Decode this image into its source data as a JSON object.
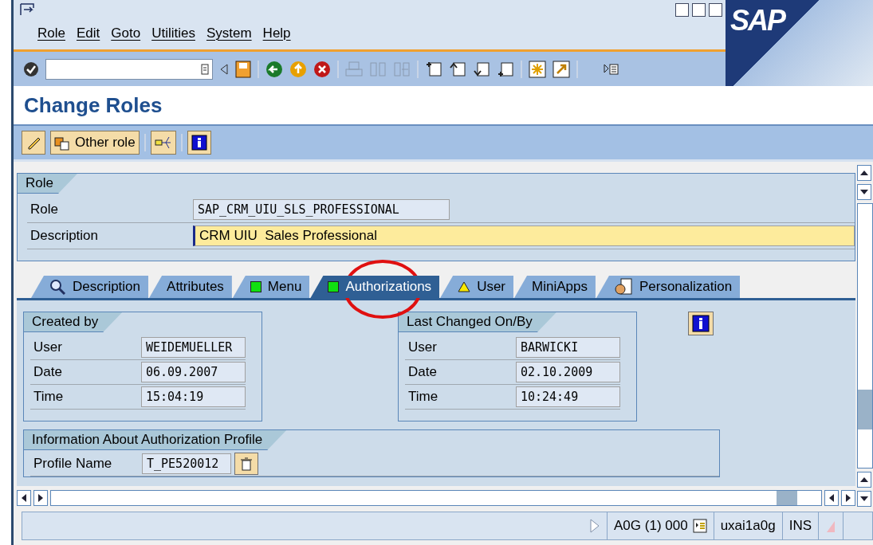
{
  "menu_bar": {
    "items": [
      "Role",
      "Edit",
      "Goto",
      "Utilities",
      "System",
      "Help"
    ]
  },
  "logo": "SAP",
  "title": "Change Roles",
  "app_toolbar": {
    "other_role_label": "Other role"
  },
  "role_group": {
    "title": "Role",
    "fields": [
      {
        "label": "Role",
        "value": "SAP_CRM_UIU_SLS_PROFESSIONAL",
        "editable": false
      },
      {
        "label": "Description",
        "value": "CRM UIU  Sales Professional",
        "editable": true
      }
    ]
  },
  "tabs": [
    {
      "label": "Description",
      "kind": "search",
      "selected": false
    },
    {
      "label": "Attributes",
      "kind": "plain",
      "selected": false
    },
    {
      "label": "Menu",
      "kind": "status",
      "color": "#10e010",
      "selected": false
    },
    {
      "label": "Authorizations",
      "kind": "status",
      "color": "#10e010",
      "selected": true
    },
    {
      "label": "User",
      "kind": "warning",
      "selected": false
    },
    {
      "label": "MiniApps",
      "kind": "plain",
      "selected": false
    },
    {
      "label": "Personalization",
      "kind": "persona",
      "selected": false
    }
  ],
  "created_by": {
    "title": "Created by",
    "fields": [
      {
        "label": "User",
        "value": "WEIDEMUELLER"
      },
      {
        "label": "Date",
        "value": "06.09.2007"
      },
      {
        "label": "Time",
        "value": "15:04:19"
      }
    ]
  },
  "last_changed": {
    "title": "Last Changed On/By",
    "fields": [
      {
        "label": "User",
        "value": "BARWICKI"
      },
      {
        "label": "Date",
        "value": "02.10.2009"
      },
      {
        "label": "Time",
        "value": "10:24:49"
      }
    ]
  },
  "profile_info": {
    "title": "Information About Authorization Profile",
    "fields": [
      {
        "label": "Profile Name",
        "value": "T_PE520012"
      }
    ]
  },
  "status_bar": {
    "system": "A0G (1) 000",
    "server": "uxai1a0g",
    "mode": "INS"
  }
}
